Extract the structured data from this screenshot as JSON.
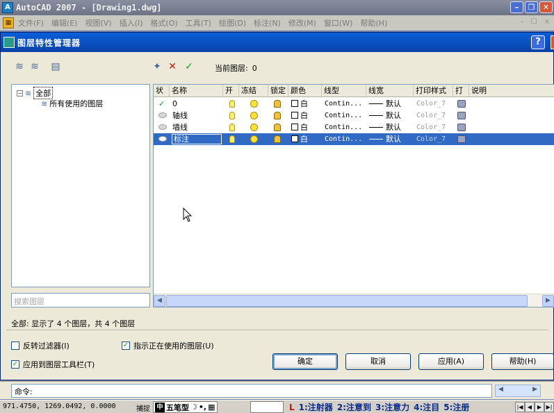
{
  "app": {
    "title": "AutoCAD 2007 - [Drawing1.dwg]",
    "logo": "A"
  },
  "menu": {
    "items": [
      "文件(F)",
      "编辑(E)",
      "视图(V)",
      "插入(I)",
      "格式(O)",
      "工具(T)",
      "绘图(D)",
      "标注(N)",
      "修改(M)",
      "窗口(W)",
      "帮助(H)"
    ],
    "right_controls": [
      "–",
      "☐",
      "×"
    ]
  },
  "dialog": {
    "title": "图层特性管理器",
    "help": "?",
    "current_layer_label": "当前图层:",
    "current_layer_value": "0",
    "tree": {
      "root": "全部",
      "child": "所有使用的图层"
    },
    "search_placeholder": "搜索图层",
    "columns": [
      "状",
      "名称",
      "开",
      "冻结",
      "锁定",
      "颜色",
      "线型",
      "线宽",
      "打印样式",
      "打",
      "说明"
    ],
    "layers": [
      {
        "status": "✓",
        "name": "0",
        "color": "白",
        "linetype": "Contin...",
        "lineweight": "默认",
        "plot_style": "Color_7",
        "selected": false
      },
      {
        "status": "",
        "name": "轴线",
        "color": "白",
        "linetype": "Contin...",
        "lineweight": "默认",
        "plot_style": "Color_7",
        "selected": false
      },
      {
        "status": "",
        "name": "墙线",
        "color": "白",
        "linetype": "Contin...",
        "lineweight": "默认",
        "plot_style": "Color_7",
        "selected": false
      },
      {
        "status": "",
        "name": "标注",
        "color": "白",
        "linetype": "Contin...",
        "lineweight": "默认",
        "plot_style": "Color_7",
        "selected": true
      }
    ],
    "status_text": "全部: 显示了 4 个图层，共 4 个图层",
    "checkboxes": {
      "invert_filter": {
        "label": "反转过滤器(I)",
        "checked": false
      },
      "apply_toolbar": {
        "label": "应用到图层工具栏(T)",
        "checked": true
      },
      "indicate_used": {
        "label": "指示正在使用的图层(U)",
        "checked": true
      }
    },
    "buttons": {
      "ok": "确定",
      "cancel": "取消",
      "apply": "应用(A)",
      "help": "帮助(H)"
    }
  },
  "command": {
    "prompt": "命令:"
  },
  "statusbar": {
    "coords": "971.4750,  1269.0492, 0.0000",
    "snap": "捕捉",
    "ime_label": "五笔型",
    "tasks": [
      "1:注射器",
      "2:注意到",
      "3:注意力",
      "4:注目",
      "5:注册"
    ],
    "task_l": "L"
  },
  "colors": {
    "dialog_title": "#0a5fd8",
    "selection": "#316ac5",
    "dialog_bg": "#ece9d8"
  }
}
